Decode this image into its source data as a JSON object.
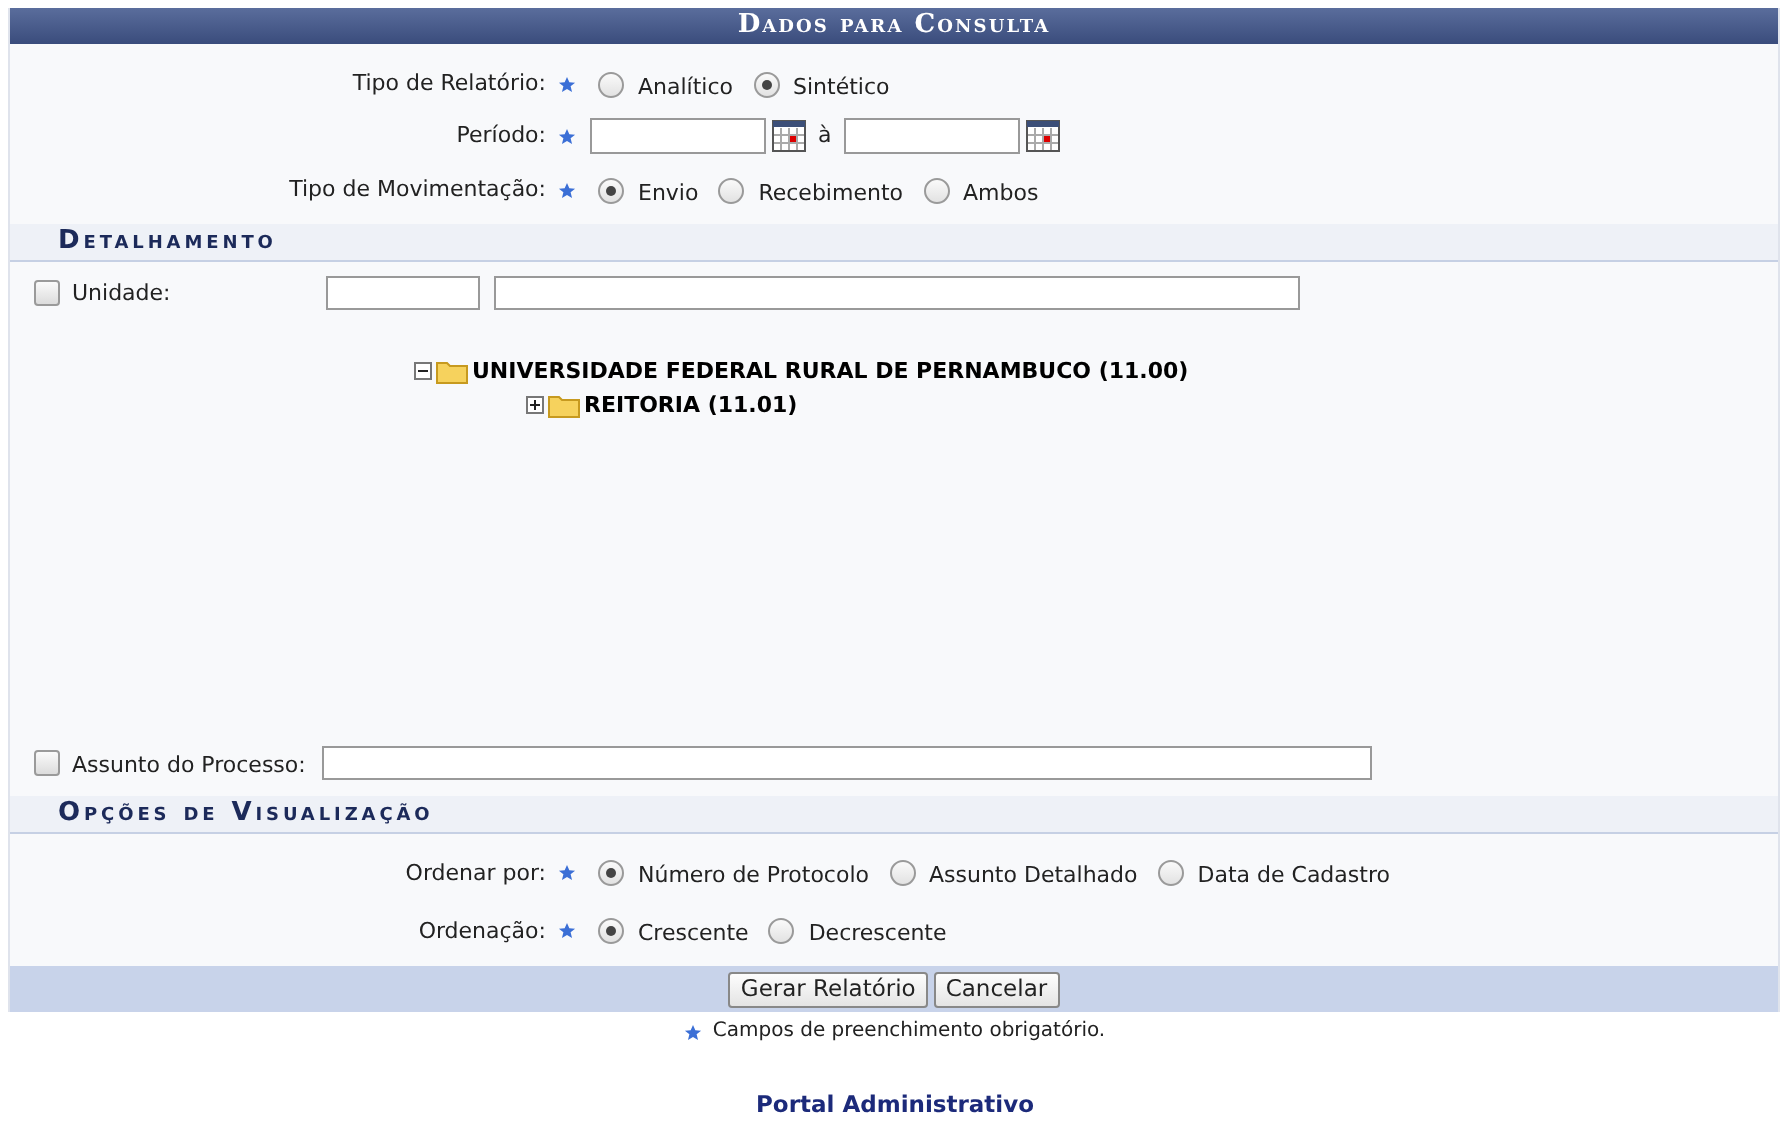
{
  "title": "Dados para Consulta",
  "main_rows": [
    {
      "kind": "radio",
      "label": "Tipo de Relatório:",
      "required": true,
      "options": [
        {
          "label": "Analítico",
          "selected": false
        },
        {
          "label": "Sintético",
          "selected": true
        }
      ]
    },
    {
      "kind": "period",
      "label": "Período:",
      "required": true,
      "separator": "à"
    },
    {
      "kind": "radio",
      "label": "Tipo de Movimentação:",
      "required": true,
      "options": [
        {
          "label": "Envio",
          "selected": true
        },
        {
          "label": "Recebimento",
          "selected": false
        },
        {
          "label": "Ambos",
          "selected": false
        }
      ]
    }
  ],
  "detalhamento": {
    "title": "Detalhamento",
    "unidade": {
      "label": "Unidade:",
      "checked": false
    },
    "tree": [
      {
        "label": "UNIVERSIDADE FEDERAL RURAL DE PERNAMBUCO (11.00)",
        "expanded": true,
        "children": [
          {
            "label": "REITORIA (11.01)",
            "expanded": false
          }
        ]
      }
    ],
    "assunto": {
      "label": "Assunto do Processo:",
      "checked": false
    }
  },
  "visualizacao": {
    "title": "Opções de Visualização",
    "rows": [
      {
        "kind": "radio",
        "label": "Ordenar por:",
        "required": true,
        "options": [
          {
            "label": "Número de Protocolo",
            "selected": true
          },
          {
            "label": "Assunto Detalhado",
            "selected": false
          },
          {
            "label": "Data de Cadastro",
            "selected": false
          }
        ]
      },
      {
        "kind": "radio",
        "label": "Ordenação:",
        "required": true,
        "options": [
          {
            "label": "Crescente",
            "selected": true
          },
          {
            "label": "Decrescente",
            "selected": false
          }
        ]
      }
    ]
  },
  "buttons": [
    "Gerar Relatório",
    "Cancelar"
  ],
  "required_note": "Campos de preenchimento obrigatório.",
  "footer": "Portal Administrativo"
}
